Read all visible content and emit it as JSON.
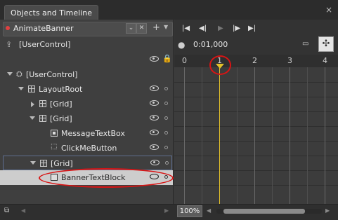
{
  "panel": {
    "title": "Objects and Timeline",
    "close_glyph": "×"
  },
  "storyboard": {
    "name": "AnimateBanner"
  },
  "scope": {
    "label": "[UserControl]"
  },
  "tree": {
    "rows": [
      {
        "label": "[UserControl]"
      },
      {
        "label": "LayoutRoot"
      },
      {
        "label": "[Grid]"
      },
      {
        "label": "[Grid]"
      },
      {
        "label": "MessageTextBox"
      },
      {
        "label": "ClickMeButton"
      },
      {
        "label": "[Grid]"
      },
      {
        "label": "BannerTextBlock"
      }
    ]
  },
  "timeline": {
    "time": "0:01,000",
    "ruler": [
      "0",
      "1",
      "2",
      "3",
      "4"
    ],
    "zoom": "100%"
  },
  "colors": {
    "playhead": "#e3c12a",
    "annotation": "#d81414",
    "selected_row": "#cdcdcd"
  }
}
